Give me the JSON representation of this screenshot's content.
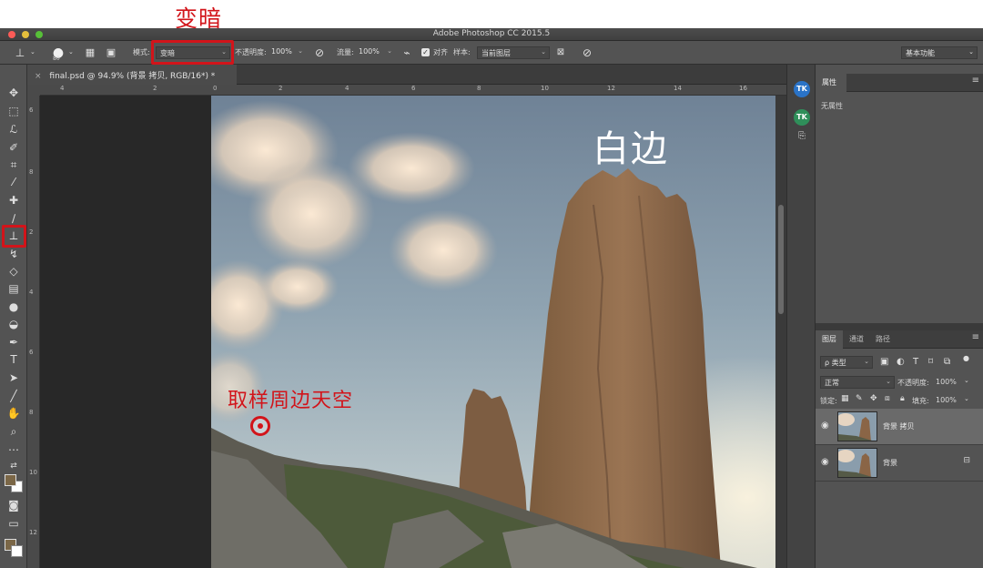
{
  "annotations": {
    "mode_callout": "变暗",
    "white_edge_label": "白边",
    "sample_sky_label": "取样周边天空"
  },
  "window": {
    "title": "Adobe Photoshop CC 2015.5"
  },
  "options_bar": {
    "brush_size": "80",
    "mode_label": "模式:",
    "mode_value": "变暗",
    "opacity_label": "不透明度:",
    "opacity_value": "100%",
    "flow_label": "流量:",
    "flow_value": "100%",
    "aligned_label": "对齐",
    "sample_label": "样本:",
    "sample_value": "当前图层",
    "workspace_value": "基本功能"
  },
  "document": {
    "tab_title": "final.psd @ 94.9% (背景 拷贝, RGB/16*) *",
    "ruler_top_ticks": [
      "4",
      "2",
      "0",
      "2",
      "4",
      "6",
      "8",
      "10",
      "12",
      "14",
      "16"
    ],
    "ruler_left_ticks": [
      "6",
      "8",
      "2",
      "4",
      "6",
      "8",
      "10",
      "12"
    ]
  },
  "properties_panel": {
    "tab_label": "属性",
    "empty_text": "无属性"
  },
  "layers_panel": {
    "tabs": [
      "图层",
      "通道",
      "路径"
    ],
    "filter_value": "ρ 类型",
    "blend_mode": "正常",
    "opacity_label": "不透明度:",
    "opacity_value": "100%",
    "lock_label": "锁定:",
    "fill_label": "填充:",
    "fill_value": "100%",
    "layers": [
      {
        "name": "背景 拷贝",
        "selected": true
      },
      {
        "name": "背景",
        "selected": false,
        "locked": true
      }
    ]
  },
  "colors": {
    "accent_red": "#d2141a",
    "foreground_swatch": "#7b6747",
    "background_swatch": "#ffffff"
  }
}
